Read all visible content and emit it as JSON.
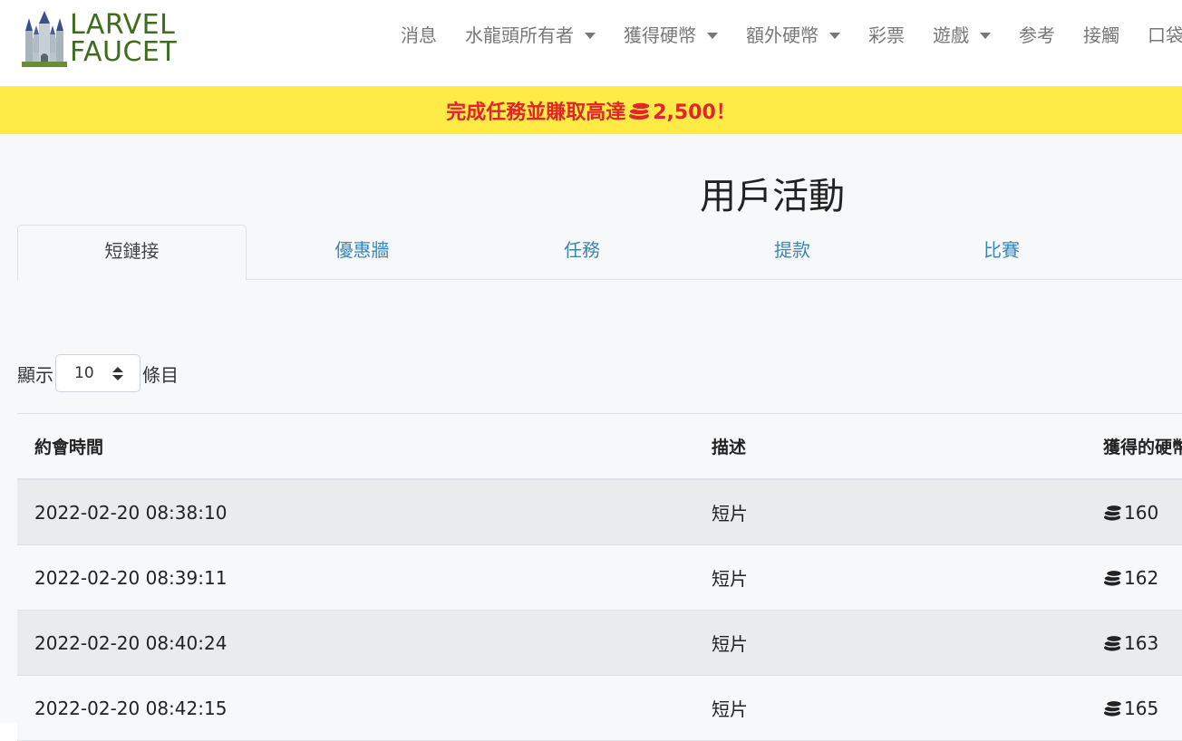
{
  "brand": {
    "line1": "LARVEL",
    "line2": "FAUCET"
  },
  "nav": [
    {
      "label": "消息",
      "dropdown": false
    },
    {
      "label": "水龍頭所有者",
      "dropdown": true
    },
    {
      "label": "獲得硬幣",
      "dropdown": true
    },
    {
      "label": "額外硬幣",
      "dropdown": true
    },
    {
      "label": "彩票",
      "dropdown": false
    },
    {
      "label": "遊戲",
      "dropdown": true
    },
    {
      "label": "参考",
      "dropdown": false
    },
    {
      "label": "接觸",
      "dropdown": false
    },
    {
      "label": "口袋",
      "dropdown": false
    }
  ],
  "banner": {
    "prefix": "完成任務並賺取高達",
    "amount": "2,500！"
  },
  "page": {
    "title": "用戶活動"
  },
  "tabs": [
    "短鏈接",
    "優惠牆",
    "任務",
    "提款",
    "比賽"
  ],
  "length": {
    "show": "顯示",
    "value": "10",
    "entries": "條目"
  },
  "table": {
    "headers": [
      "約會時間",
      "描述",
      "獲得的硬幣"
    ],
    "rows": [
      {
        "time": "2022-02-20 08:38:10",
        "desc": "短片",
        "coins": "160"
      },
      {
        "time": "2022-02-20 08:39:11",
        "desc": "短片",
        "coins": "162"
      },
      {
        "time": "2022-02-20 08:40:24",
        "desc": "短片",
        "coins": "163"
      },
      {
        "time": "2022-02-20 08:42:15",
        "desc": "短片",
        "coins": "165"
      }
    ]
  },
  "colors": {
    "brand": "#3f6d1f",
    "banner_bg": "#ffeb45",
    "banner_text": "#e0262b",
    "tab_link": "#3a86b5",
    "nav_text": "#777777"
  },
  "icons": {
    "logo": "castle-icon",
    "coin": "coins-icon"
  }
}
